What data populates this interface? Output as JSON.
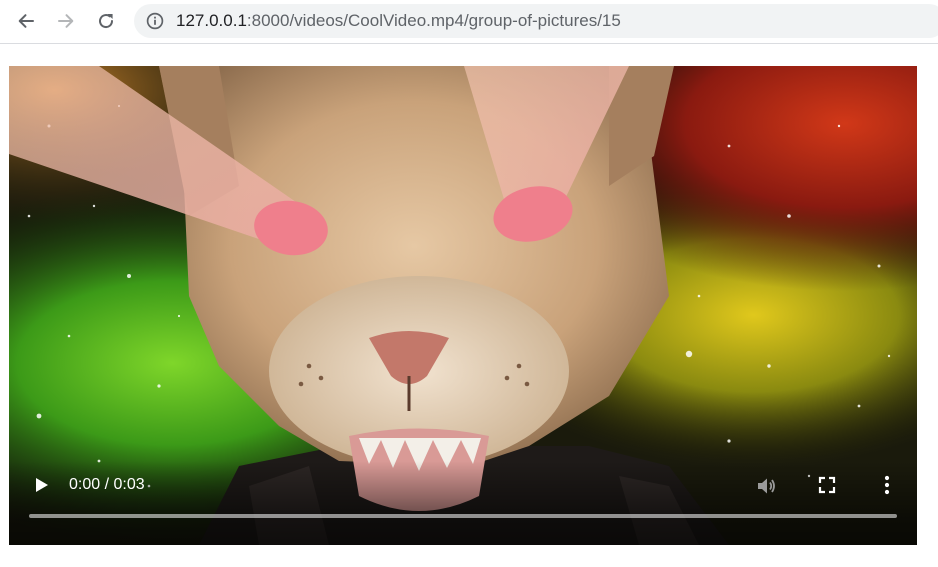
{
  "browser": {
    "icons": {
      "back": "arrow-left-icon",
      "forward": "arrow-right-icon",
      "reload": "reload-icon",
      "site_info": "info-icon"
    },
    "url": {
      "host": "127.0.0.1",
      "path": ":8000/videos/CoolVideo.mp4/group-of-pictures/15"
    }
  },
  "video": {
    "current_time": "0:00",
    "separator": " / ",
    "duration": "0:03",
    "progress": 0.0,
    "controls": {
      "play": "play-icon",
      "volume": "volume-icon",
      "fullscreen": "fullscreen-icon",
      "more": "more-vertical-icon"
    }
  },
  "colors": {
    "toolbar_bg": "#ffffff",
    "omnibox_bg": "#f1f3f4",
    "icon": "#5f6368",
    "text": "#202124"
  }
}
